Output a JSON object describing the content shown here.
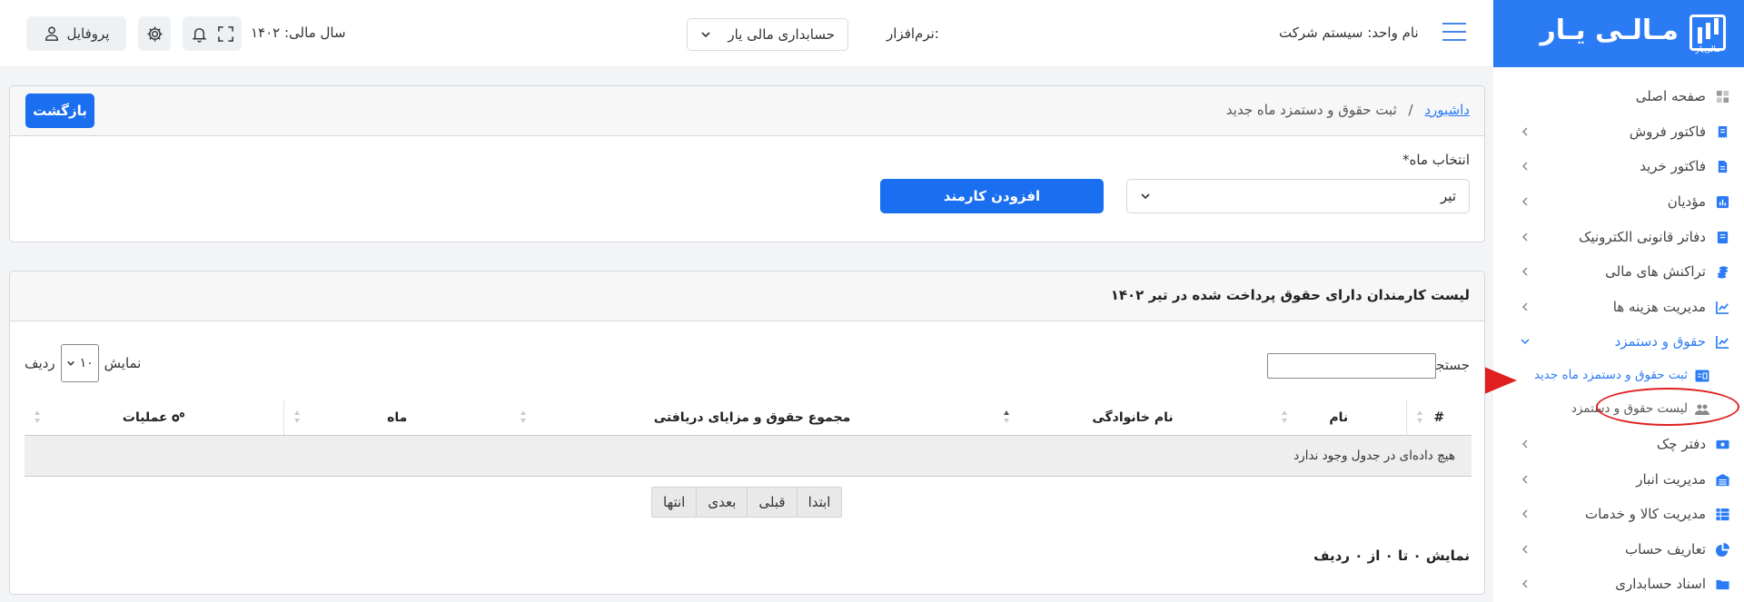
{
  "brand": {
    "name": "مـالـی یـار",
    "sub": "مالی‌یار"
  },
  "header": {
    "unit_label": "نام واحد: سیستم شرکت",
    "software_label": "نرم‌افزار:",
    "software_value": "حسابداری مالی یار",
    "fiscal_year": "سال مالی: ۱۴۰۲",
    "profile_label": "پروفایل"
  },
  "sidebar": {
    "items": [
      {
        "label": "صفحه اصلی",
        "icon": "dashboard-icon",
        "has_chevron": false
      },
      {
        "label": "فاکتور فروش",
        "icon": "invoice-icon",
        "has_chevron": true
      },
      {
        "label": "فاکتور خرید",
        "icon": "document-icon",
        "has_chevron": true
      },
      {
        "label": "مؤدیان",
        "icon": "bar-chart-icon",
        "has_chevron": true
      },
      {
        "label": "دفاتر قانونی الکترونیک",
        "icon": "book-icon",
        "has_chevron": true
      },
      {
        "label": "تراکنش های مالی",
        "icon": "coins-icon",
        "has_chevron": true
      },
      {
        "label": "مدیریت هزینه ها",
        "icon": "line-chart-icon",
        "has_chevron": true
      },
      {
        "label": "حقوق و دستمزد",
        "icon": "line-chart-icon",
        "has_chevron": true,
        "active": true
      },
      {
        "label": "دفتر چک",
        "icon": "money-icon",
        "has_chevron": true
      },
      {
        "label": "مدیریت انبار",
        "icon": "warehouse-icon",
        "has_chevron": true
      },
      {
        "label": "مدیریت کالا و خدمات",
        "icon": "table-icon",
        "has_chevron": true
      },
      {
        "label": "تعاریف حساب",
        "icon": "pie-chart-icon",
        "has_chevron": true
      },
      {
        "label": "اسناد حسابداری",
        "icon": "folder-icon",
        "has_chevron": true
      }
    ],
    "subitems": [
      {
        "label": "ثبت حقوق و دستمزد ماه جدید",
        "icon": "id-card-icon",
        "active": true
      },
      {
        "label": "لیست حقوق و دستمزد",
        "icon": "users-icon",
        "active": false
      }
    ]
  },
  "breadcrumb": {
    "home": "داشبورد",
    "separator": "/",
    "current": "ثبت حقوق و دستمزد ماه جدید"
  },
  "back_button": "بازگشت",
  "form": {
    "month_label": "انتخاب ماه*",
    "month_value": "تیر",
    "add_employee_button": "افزودن کارمند"
  },
  "list": {
    "title": "لیست کارمندان دارای حقوق پرداخت شده در تیر ۱۴۰۲",
    "search_label": "جستجو:",
    "search_value": "",
    "show_label": "نمایش",
    "rows_label": "ردیف",
    "page_length": "۱۰",
    "columns": [
      "#",
      "نام",
      "نام خانوادگی",
      "مجموع حقوق و مزایای دریافتی",
      "ماه",
      "عملیات"
    ],
    "empty_message": "هیچ داده‌ای در جدول وجود ندارد",
    "pager": [
      "ابتدا",
      "قبلی",
      "بعدی",
      "انتها"
    ],
    "info": "نمایش ۰ تا ۰ از ۰ ردیف"
  },
  "colors": {
    "primary": "#1a6ef0",
    "brand": "#2b7bf5",
    "highlight": "#e02020"
  }
}
